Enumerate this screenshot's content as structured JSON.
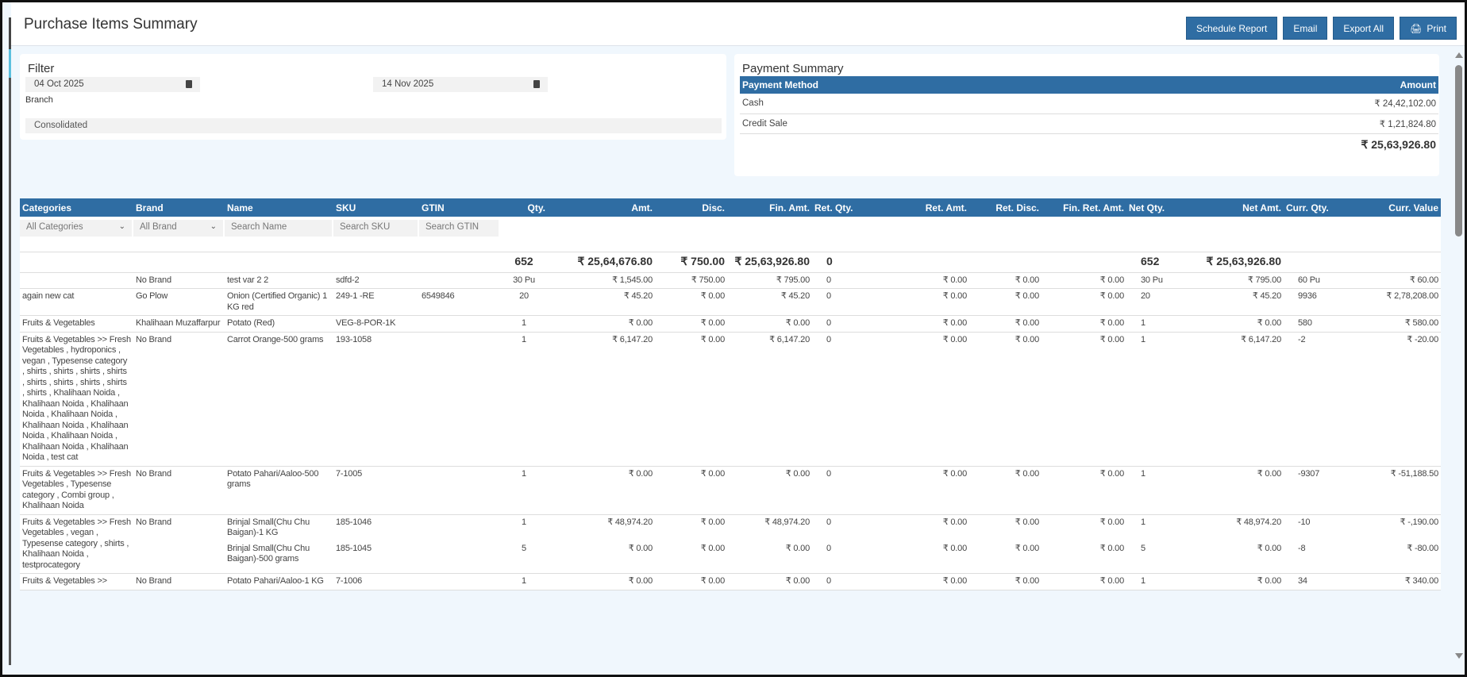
{
  "header": {
    "title": "Purchase Items Summary",
    "buttons": {
      "schedule": "Schedule Report",
      "email": "Email",
      "export": "Export All",
      "print": "Print"
    }
  },
  "filter": {
    "title": "Filter",
    "from_date": "04 Oct 2025",
    "to_date": "14 Nov 2025",
    "branch_label": "Branch",
    "branch_value": "Consolidated"
  },
  "payment_summary": {
    "title": "Payment Summary",
    "col_method": "Payment Method",
    "col_amount": "Amount",
    "rows": [
      {
        "method": "Cash",
        "amount": "₹ 24,42,102.00"
      },
      {
        "method": "Credit Sale",
        "amount": "₹ 1,21,824.80"
      }
    ],
    "total": "₹ 25,63,926.80"
  },
  "table": {
    "columns": [
      "Categories",
      "Brand",
      "Name",
      "SKU",
      "GTIN",
      "Qty.",
      "Amt.",
      "Disc.",
      "Fin. Amt.",
      "Ret. Qty.",
      "Ret. Amt.",
      "Ret. Disc.",
      "Fin. Ret. Amt.",
      "Net Qty.",
      "Net Amt.",
      "Curr. Qty.",
      "Curr. Value"
    ],
    "filters": {
      "categories": "All Categories",
      "brand": "All Brand",
      "name_placeholder": "Search Name",
      "sku_placeholder": "Search SKU",
      "gtin_placeholder": "Search GTIN"
    },
    "totals": {
      "qty": "652",
      "amt": "₹ 25,64,676.80",
      "disc": "₹ 750.00",
      "fin_amt": "₹ 25,63,926.80",
      "ret_qty": "0",
      "net_qty": "652",
      "net_amt": "₹ 25,63,926.80"
    },
    "rows": [
      {
        "category": "",
        "brand": "No Brand",
        "items": [
          {
            "name": "test var 2 2",
            "sku": "sdfd-2",
            "gtin": "",
            "qty": "30 Pu",
            "amt": "₹ 1,545.00",
            "disc": "₹ 750.00",
            "fin_amt": "₹ 795.00",
            "ret_qty": "0",
            "ret_amt": "₹ 0.00",
            "ret_disc": "₹ 0.00",
            "fin_ret_amt": "₹ 0.00",
            "net_qty": "30 Pu",
            "net_amt": "₹ 795.00",
            "curr_qty": "60 Pu",
            "curr_value": "₹ 60.00"
          }
        ]
      },
      {
        "category": "again new cat",
        "brand": "Go Plow",
        "items": [
          {
            "name": "Onion (Certified Organic) 1 KG red",
            "sku": "249-1 -RE",
            "gtin": "6549846",
            "qty": "20",
            "amt": "₹ 45.20",
            "disc": "₹ 0.00",
            "fin_amt": "₹ 45.20",
            "ret_qty": "0",
            "ret_amt": "₹ 0.00",
            "ret_disc": "₹ 0.00",
            "fin_ret_amt": "₹ 0.00",
            "net_qty": "20",
            "net_amt": "₹ 45.20",
            "curr_qty": "9936",
            "curr_value": "₹ 2,78,208.00"
          }
        ]
      },
      {
        "category": "Fruits & Vegetables",
        "brand": "Khalihaan Muzaffarpur",
        "items": [
          {
            "name": "Potato (Red)",
            "sku": "VEG-8-POR-1K",
            "gtin": "",
            "qty": "1",
            "amt": "₹ 0.00",
            "disc": "₹ 0.00",
            "fin_amt": "₹ 0.00",
            "ret_qty": "0",
            "ret_amt": "₹ 0.00",
            "ret_disc": "₹ 0.00",
            "fin_ret_amt": "₹ 0.00",
            "net_qty": "1",
            "net_amt": "₹ 0.00",
            "curr_qty": "580",
            "curr_value": "₹ 580.00"
          }
        ]
      },
      {
        "category": "Fruits & Vegetables >> Fresh Vegetables , hydroponics , vegan , Typesense category , shirts , shirts , shirts , shirts , shirts , shirts , shirts , shirts , shirts , Khalihaan Noida , Khalihaan Noida , Khalihaan Noida , Khalihaan Noida , Khalihaan Noida , Khalihaan Noida , Khalihaan Noida , Khalihaan Noida , Khalihaan Noida , test cat",
        "brand": "No Brand",
        "items": [
          {
            "name": "Carrot Orange-500 grams",
            "sku": "193-1058",
            "gtin": "",
            "qty": "1",
            "amt": "₹ 6,147.20",
            "disc": "₹ 0.00",
            "fin_amt": "₹ 6,147.20",
            "ret_qty": "0",
            "ret_amt": "₹ 0.00",
            "ret_disc": "₹ 0.00",
            "fin_ret_amt": "₹ 0.00",
            "net_qty": "1",
            "net_amt": "₹ 6,147.20",
            "curr_qty": "-2",
            "curr_value": "₹ -20.00"
          }
        ]
      },
      {
        "category": "Fruits & Vegetables >> Fresh Vegetables , Typesense category , Combi group , Khalihaan Noida",
        "brand": "No Brand",
        "items": [
          {
            "name": "Potato Pahari/Aaloo-500 grams",
            "sku": "7-1005",
            "gtin": "",
            "qty": "1",
            "amt": "₹ 0.00",
            "disc": "₹ 0.00",
            "fin_amt": "₹ 0.00",
            "ret_qty": "0",
            "ret_amt": "₹ 0.00",
            "ret_disc": "₹ 0.00",
            "fin_ret_amt": "₹ 0.00",
            "net_qty": "1",
            "net_amt": "₹ 0.00",
            "curr_qty": "-9307",
            "curr_value": "₹ -51,188.50"
          }
        ]
      },
      {
        "category": "Fruits & Vegetables >> Fresh Vegetables , vegan , Typesense category , shirts , Khalihaan Noida , testprocategory",
        "brand": "No Brand",
        "items": [
          {
            "name": "Brinjal Small(Chu Chu Baigan)-1 KG",
            "sku": "185-1046",
            "gtin": "",
            "qty": "1",
            "amt": "₹ 48,974.20",
            "disc": "₹ 0.00",
            "fin_amt": "₹ 48,974.20",
            "ret_qty": "0",
            "ret_amt": "₹ 0.00",
            "ret_disc": "₹ 0.00",
            "fin_ret_amt": "₹ 0.00",
            "net_qty": "1",
            "net_amt": "₹ 48,974.20",
            "curr_qty": "-10",
            "curr_value": "₹ -,190.00"
          },
          {
            "name": "Brinjal Small(Chu Chu Baigan)-500 grams",
            "sku": "185-1045",
            "gtin": "",
            "qty": "5",
            "amt": "₹ 0.00",
            "disc": "₹ 0.00",
            "fin_amt": "₹ 0.00",
            "ret_qty": "0",
            "ret_amt": "₹ 0.00",
            "ret_disc": "₹ 0.00",
            "fin_ret_amt": "₹ 0.00",
            "net_qty": "5",
            "net_amt": "₹ 0.00",
            "curr_qty": "-8",
            "curr_value": "₹ -80.00"
          }
        ]
      },
      {
        "category": "Fruits & Vegetables >>",
        "brand": "No Brand",
        "items": [
          {
            "name": "Potato Pahari/Aaloo-1 KG",
            "sku": "7-1006",
            "gtin": "",
            "qty": "1",
            "amt": "₹ 0.00",
            "disc": "₹ 0.00",
            "fin_amt": "₹ 0.00",
            "ret_qty": "0",
            "ret_amt": "₹ 0.00",
            "ret_disc": "₹ 0.00",
            "fin_ret_amt": "₹ 0.00",
            "net_qty": "1",
            "net_amt": "₹ 0.00",
            "curr_qty": "34",
            "curr_value": "₹ 340.00"
          }
        ]
      }
    ]
  }
}
